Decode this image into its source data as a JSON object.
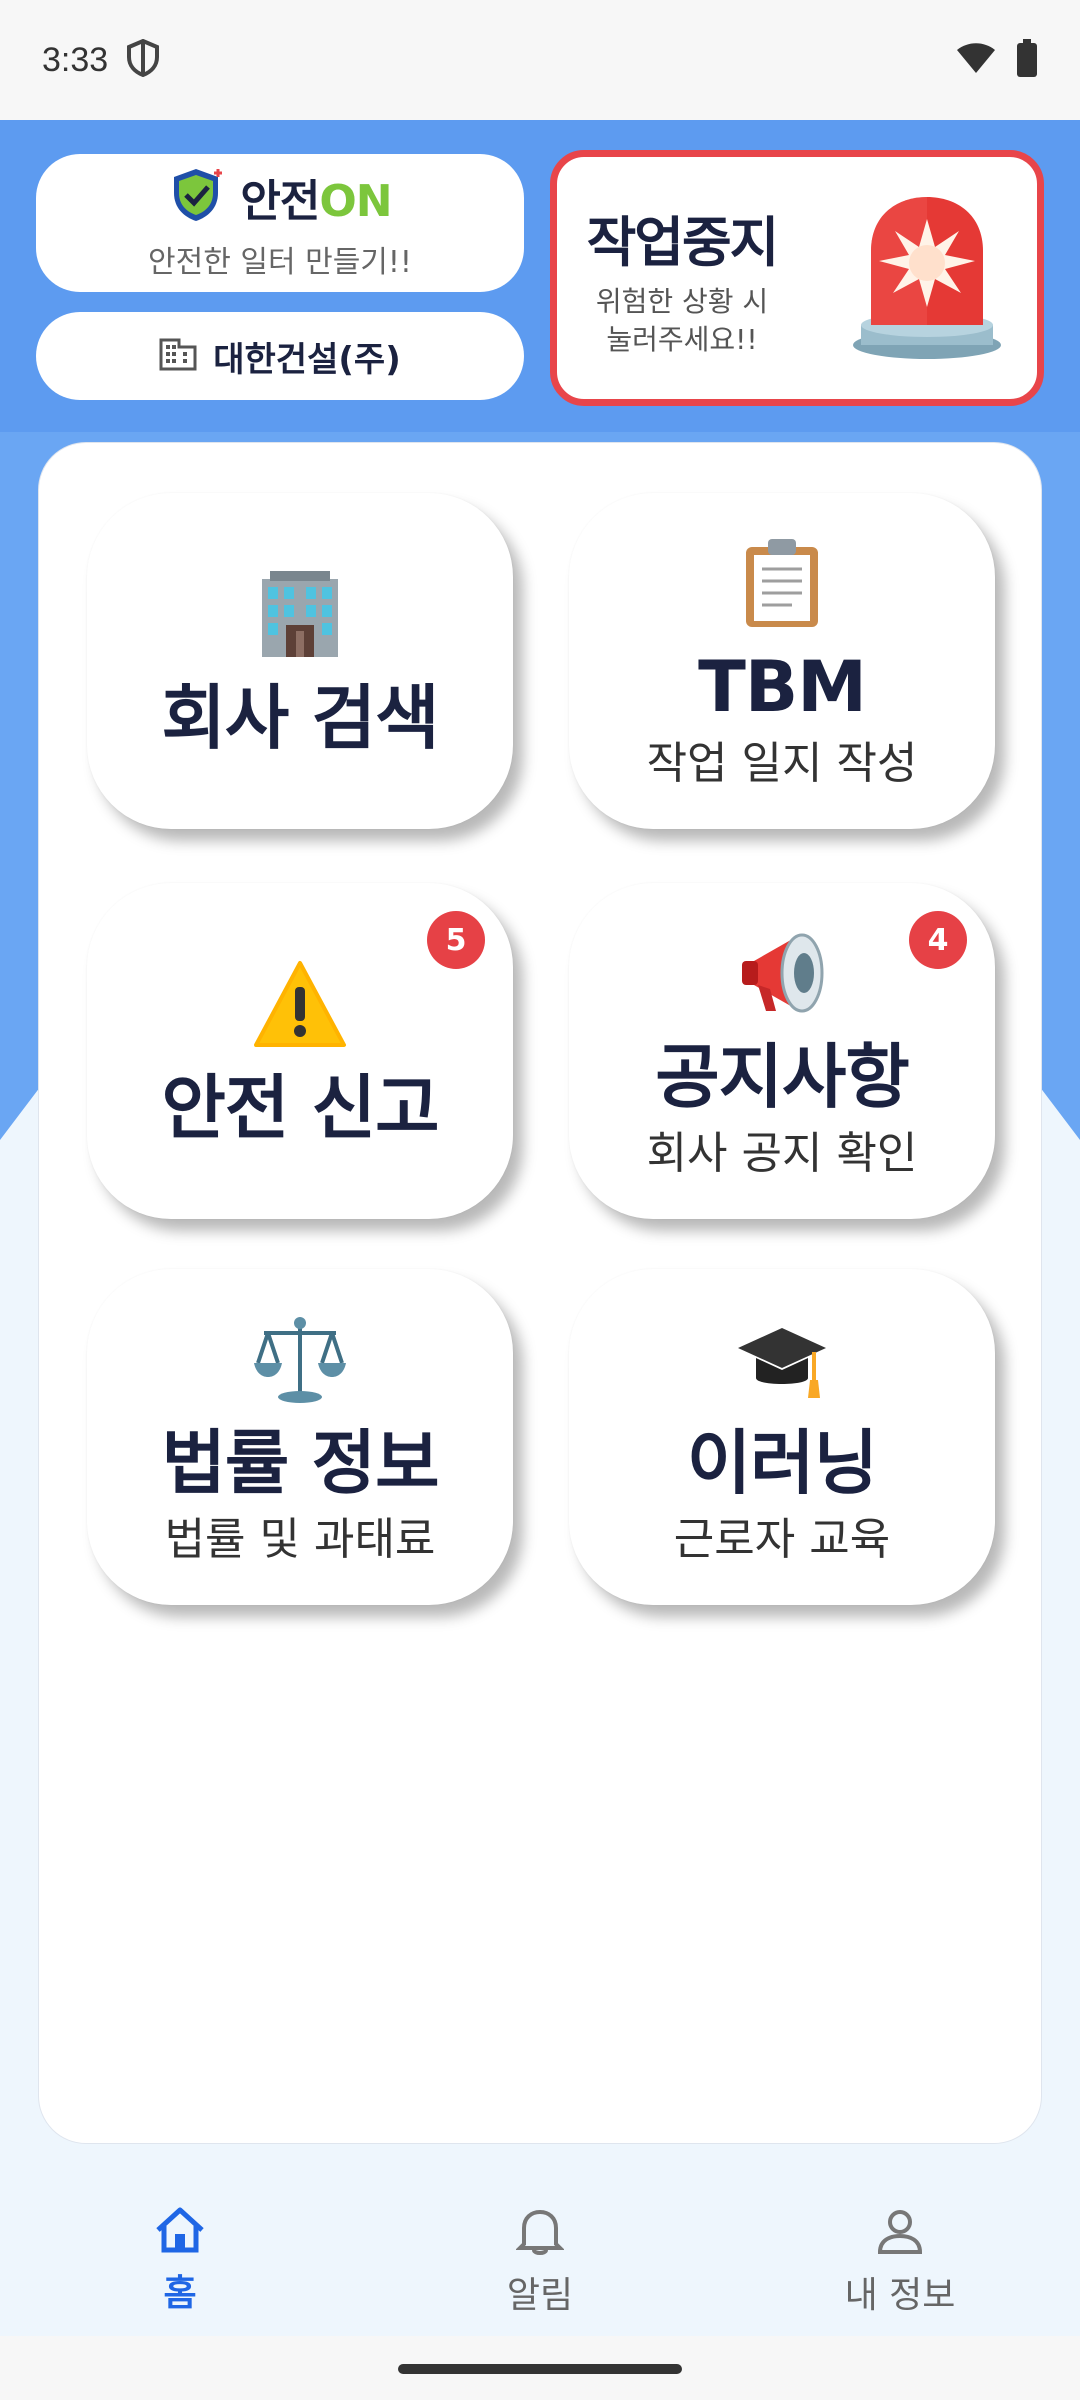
{
  "status_bar": {
    "time": "3:33"
  },
  "header": {
    "logo_title_main": "안전",
    "logo_title_accent": "ON",
    "logo_subtitle": "안전한 일터 만들기!!",
    "company_name": "대한건설(주)",
    "stop_title": "작업중지",
    "stop_subtitle_line1": "위험한 상황 시",
    "stop_subtitle_line2": "눌러주세요!!"
  },
  "tiles": [
    {
      "title": "회사 검색",
      "subtitle": "",
      "icon": "office-building-icon",
      "badge": ""
    },
    {
      "title": "TBM",
      "subtitle": "작업 일지 작성",
      "icon": "clipboard-icon",
      "badge": ""
    },
    {
      "title": "안전 신고",
      "subtitle": "",
      "icon": "warning-icon",
      "badge": "5"
    },
    {
      "title": "공지사항",
      "subtitle": "회사 공지 확인",
      "icon": "megaphone-icon",
      "badge": "4"
    },
    {
      "title": "법률 정보",
      "subtitle": "법률 및 과태료",
      "icon": "scales-icon",
      "badge": ""
    },
    {
      "title": "이러닝",
      "subtitle": "근로자 교육",
      "icon": "graduation-cap-icon",
      "badge": ""
    }
  ],
  "nav": [
    {
      "label": "홈",
      "icon": "home-icon",
      "active": true
    },
    {
      "label": "알림",
      "icon": "bell-icon",
      "active": false
    },
    {
      "label": "내 정보",
      "icon": "person-icon",
      "active": false
    }
  ],
  "colors": {
    "primary_blue": "#5d9bf0",
    "accent_red": "#e8454a",
    "nav_active": "#1f66e5",
    "brand_green": "#7cc63c"
  }
}
